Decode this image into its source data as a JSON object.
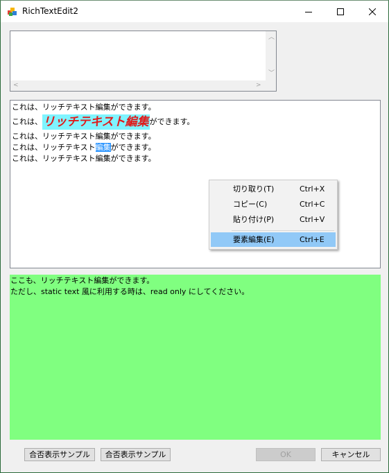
{
  "window": {
    "title": "RichTextEdit2"
  },
  "rich_text": {
    "line1": "これは、リッチテキスト編集ができます。",
    "line2_prefix": "これは、",
    "line2_styled": "リッチテキスト編集",
    "line2_suffix": "ができます。",
    "line3": "これは、リッチテキスト編集ができます。",
    "line4_prefix": "これは、リッチテキスト",
    "line4_selected": "編集",
    "line4_suffix": "ができます。",
    "line5": "これは、リッチテキスト編集ができます。",
    "styled_colors": {
      "text": "#e01b1b",
      "highlight": "#7ff4ff"
    }
  },
  "context_menu": {
    "items": [
      {
        "label": "切り取り(T)",
        "shortcut": "Ctrl+X"
      },
      {
        "label": "コピー(C)",
        "shortcut": "Ctrl+C"
      },
      {
        "label": "貼り付け(P)",
        "shortcut": "Ctrl+V"
      },
      {
        "label": "要素編集(E)",
        "shortcut": "Ctrl+E"
      }
    ]
  },
  "static_box": {
    "line1": "ここも、リッチテキスト編集ができます。",
    "line2": "ただし、static text 風に利用する時は、read only にしてください。",
    "background": "#80ff80"
  },
  "buttons": {
    "sample1": "合否表示サンプル",
    "sample2": "合否表示サンプル",
    "ok": "OK",
    "cancel": "キャンセル"
  }
}
